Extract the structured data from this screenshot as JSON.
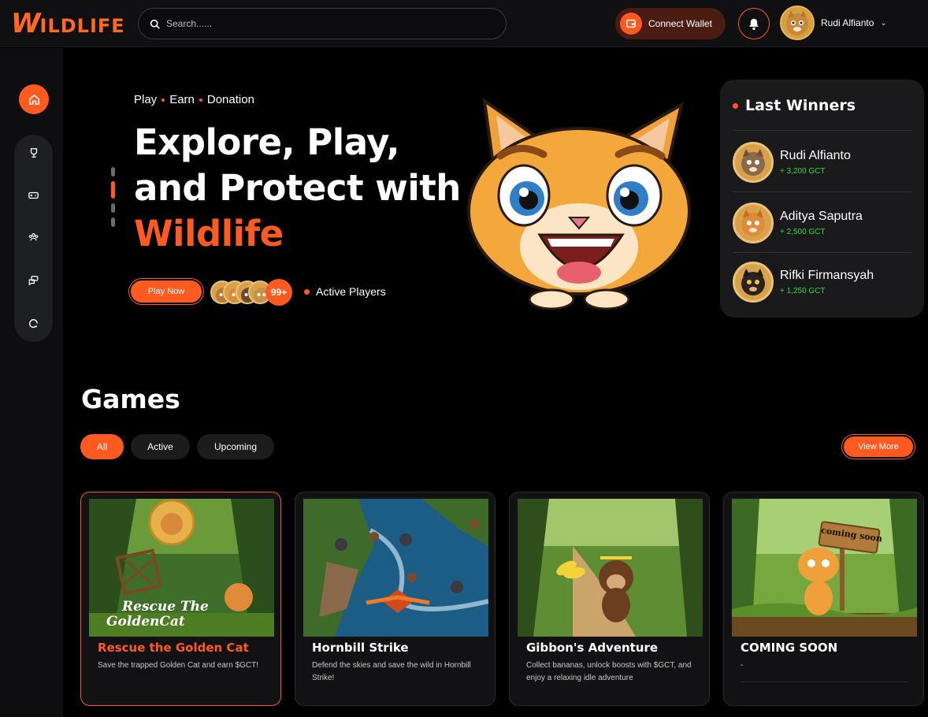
{
  "header": {
    "logo_w": "W",
    "logo_rest": "ILDLIFE",
    "search_placeholder": "Search......",
    "connect_wallet_label": "Connect Wallet",
    "user_name": "Rudi Alfianto"
  },
  "hero": {
    "tags": [
      "Play",
      "Earn",
      "Donation"
    ],
    "title_line1": "Explore, Play,",
    "title_line2": "and Protect with",
    "title_accent": "Wildlife",
    "play_button": "Play Now",
    "players_count": "99+",
    "active_players_label": "Active Players"
  },
  "winners": {
    "title": "Last Winners",
    "items": [
      {
        "name": "Rudi Alfianto",
        "amount": "+ 3,200 GCT"
      },
      {
        "name": "Aditya Saputra",
        "amount": "+ 2,500 GCT"
      },
      {
        "name": "Rifki Firmansyah",
        "amount": "+ 1,250 GCT"
      }
    ]
  },
  "games": {
    "title": "Games",
    "filters": [
      "All",
      "Active",
      "Upcoming"
    ],
    "active_filter": "All",
    "view_more": "View More",
    "cards": [
      {
        "title": "Rescue the Golden Cat",
        "desc": "Save the trapped Golden Cat and earn $GCT!",
        "art_text_1": "Rescue The",
        "art_text_2": "GoldenCat"
      },
      {
        "title": "Hornbill Strike",
        "desc": "Defend the skies and save the wild in Hornbill Strike!"
      },
      {
        "title": "Gibbon's Adventure",
        "desc": "Collect bananas, unlock boosts with $GCT, and enjoy a relaxing idle adventure"
      },
      {
        "title": "COMING SOON",
        "desc": "-",
        "sign_text": "coming soon"
      }
    ]
  },
  "colors": {
    "accent": "#ff5a1f",
    "win_green": "#32d74b",
    "bg": "#000000"
  }
}
